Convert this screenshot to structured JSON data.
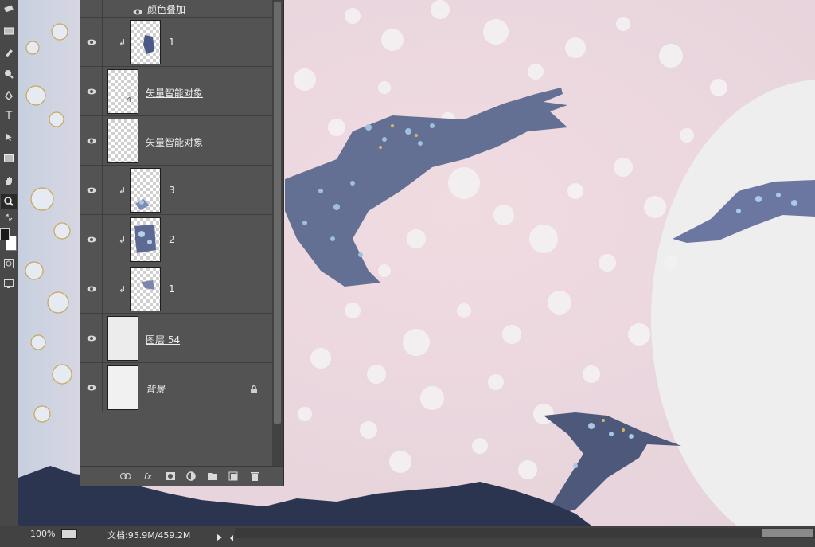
{
  "layers_panel": {
    "effect_row": {
      "label": "颜色叠加"
    },
    "layers": [
      {
        "name": "1",
        "clipped": true,
        "thumb": "transparent-art",
        "underline": false
      },
      {
        "name": "矢量智能对象",
        "clipped": false,
        "thumb": "transparent",
        "underline": true
      },
      {
        "name": "矢量智能对象",
        "clipped": false,
        "thumb": "transparent",
        "underline": false
      },
      {
        "name": "3",
        "clipped": true,
        "thumb": "transparent-art",
        "underline": false
      },
      {
        "name": "2",
        "clipped": true,
        "thumb": "transparent-art",
        "underline": false
      },
      {
        "name": "1",
        "clipped": true,
        "thumb": "transparent-art",
        "underline": false
      },
      {
        "name": "图层 54",
        "clipped": false,
        "thumb": "transparent-light",
        "underline": true
      },
      {
        "name": "背景",
        "clipped": false,
        "thumb": "white",
        "underline": false,
        "locked": true
      }
    ],
    "footer_icons": [
      "link-icon",
      "fx-icon",
      "mask-icon",
      "adjustment-icon",
      "folder-icon",
      "new-layer-icon",
      "trash-icon"
    ],
    "fx_label": "fx"
  },
  "toolbar": {
    "tools": [
      "eraser-icon",
      "gradient-icon",
      "smudge-icon",
      "dodge-icon",
      "pen-icon",
      "type-icon",
      "path-select-icon",
      "rectangle-icon",
      "hand-icon",
      "zoom-icon",
      "swap-colors-icon",
      "color-swatches",
      "quick-mask-icon",
      "screen-mode-icon"
    ],
    "type_glyph": "T",
    "foreground_color": "#1a1a1a",
    "background_color": "#ffffff"
  },
  "status_bar": {
    "zoom": "100%",
    "doc_info": "文档:95.9M/459.2M"
  },
  "colors": {
    "canvas_pink": "#ecd8de",
    "canvas_white": "#efeeee",
    "bird_blue": "#5f6a90",
    "ink_dark": "#2c3550"
  }
}
